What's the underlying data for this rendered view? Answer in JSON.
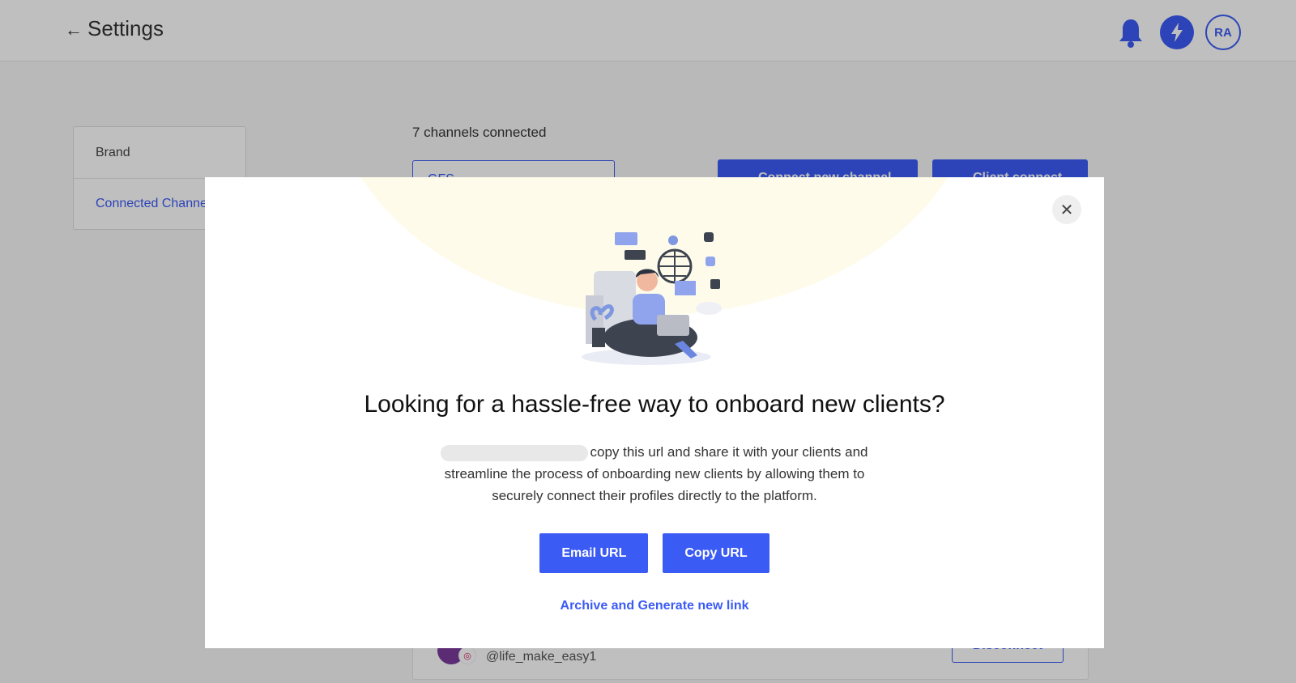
{
  "header": {
    "title": "Settings",
    "avatar_initials": "RA"
  },
  "sidebar": {
    "items": [
      {
        "label": "Brand"
      },
      {
        "label": "Connected Channels"
      }
    ]
  },
  "main": {
    "channels_count": "7 channels connected",
    "brand_select_value": "GFS",
    "connect_button": "Connect new channel",
    "client_connect_button": "Client connect",
    "channel_row": {
      "handle": "@life_make_easy1",
      "disconnect_label": "Disconnect"
    }
  },
  "modal": {
    "heading": "Looking for a hassle-free way to onboard new clients?",
    "body": "copy this url and share it with your clients and streamline the process of onboarding new clients by allowing them to securely connect their profiles directly to the platform.",
    "email_button": "Email URL",
    "copy_button": "Copy URL",
    "archive_link": "Archive and Generate new link"
  },
  "colors": {
    "accent": "#3b5bf5",
    "glow": "#fffbeb"
  },
  "icons": [
    "back-arrow-icon",
    "bell-icon",
    "bolt-icon",
    "chevron-down-icon",
    "close-icon",
    "globe-icon",
    "instagram-icon"
  ]
}
